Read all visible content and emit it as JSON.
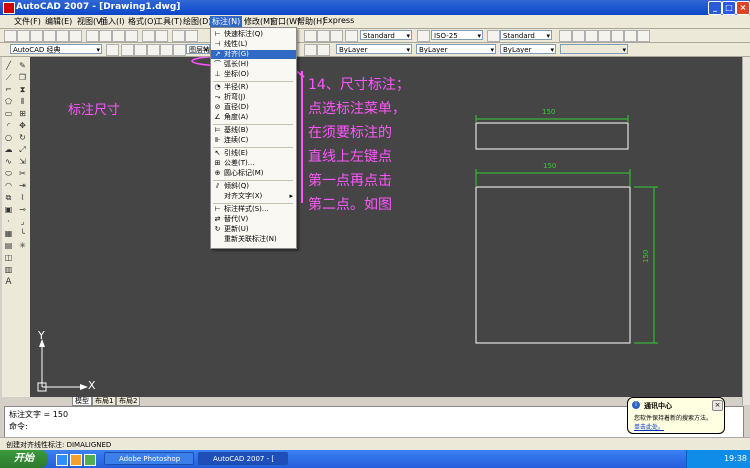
{
  "window": {
    "title": "AutoCAD 2007 - [Drawing1.dwg]",
    "controls": [
      "_",
      "□",
      "×"
    ]
  },
  "menubar": {
    "items": [
      {
        "label": "文件(F)"
      },
      {
        "label": "编辑(E)"
      },
      {
        "label": "视图(V)"
      },
      {
        "label": "插入(I)"
      },
      {
        "label": "格式(O)"
      },
      {
        "label": "工具(T)"
      },
      {
        "label": "绘图(D)"
      },
      {
        "label": "标注(N)",
        "active": true
      },
      {
        "label": "修改(M)"
      },
      {
        "label": "窗口(W)"
      },
      {
        "label": "帮助(H)"
      },
      {
        "label": "Express"
      }
    ]
  },
  "toolbar": {
    "text_style": "Standard",
    "dim_style": "ISO-25",
    "table_style": "Standard",
    "workspace": "AutoCAD 经典",
    "layer_label": "图层特",
    "color": "ByLayer",
    "linetype": "ByLayer",
    "lineweight": "ByLayer"
  },
  "dropdown": {
    "items": [
      {
        "icon": "quick-dim-icon",
        "glyph": "⊢",
        "label": "快速标注(Q)",
        "sep_after": false
      },
      {
        "icon": "linear-dim-icon",
        "glyph": "⊣",
        "label": "线性(L)",
        "sep_after": false
      },
      {
        "icon": "aligned-dim-icon",
        "glyph": "↗",
        "label": "对齐(G)",
        "selected": true,
        "sep_after": false
      },
      {
        "icon": "arc-length-icon",
        "glyph": "⌒",
        "label": "弧长(H)",
        "sep_after": false
      },
      {
        "icon": "ordinate-icon",
        "glyph": "⊥",
        "label": "坐标(O)",
        "sep_after": true
      },
      {
        "icon": "radius-icon",
        "glyph": "◔",
        "label": "半径(R)",
        "sep_after": false
      },
      {
        "icon": "jogged-icon",
        "glyph": "⤳",
        "label": "折弯(J)",
        "sep_after": false
      },
      {
        "icon": "diameter-icon",
        "glyph": "⊘",
        "label": "直径(D)",
        "sep_after": false
      },
      {
        "icon": "angular-icon",
        "glyph": "∠",
        "label": "角度(A)",
        "sep_after": true
      },
      {
        "icon": "baseline-icon",
        "glyph": "⊨",
        "label": "基线(B)",
        "sep_after": false
      },
      {
        "icon": "continue-icon",
        "glyph": "⊪",
        "label": "连续(C)",
        "sep_after": true
      },
      {
        "icon": "leader-icon",
        "glyph": "↖",
        "label": "引线(E)",
        "sep_after": false
      },
      {
        "icon": "tolerance-icon",
        "glyph": "⊞",
        "label": "公差(T)...",
        "sep_after": false
      },
      {
        "icon": "center-mark-icon",
        "glyph": "⊕",
        "label": "圆心标记(M)",
        "sep_after": true
      },
      {
        "icon": "oblique-icon",
        "glyph": "⫽",
        "label": "倾斜(Q)",
        "sep_after": false
      },
      {
        "icon": "",
        "glyph": "",
        "label": "对齐文字(X)",
        "submenu": true,
        "sep_after": true
      },
      {
        "icon": "dim-style-icon",
        "glyph": "⊢",
        "label": "标注样式(S)...",
        "sep_after": false
      },
      {
        "icon": "override-icon",
        "glyph": "⇄",
        "label": "替代(V)",
        "sep_after": false
      },
      {
        "icon": "update-icon",
        "glyph": "↻",
        "label": "更新(U)",
        "sep_after": false
      },
      {
        "icon": "",
        "glyph": "",
        "label": "重新关联标注(N)",
        "sep_after": false
      }
    ]
  },
  "canvas": {
    "label_left": "标注尺寸",
    "instructions": [
      "14、尺寸标注；",
      "点选标注菜单，",
      "在须要标注的",
      "直线上左键点",
      "第一点再点击",
      "第二点。如图"
    ],
    "dim_top": "150",
    "dim_middle": "150",
    "dim_right": "150",
    "ucs_x": "X",
    "ucs_y": "Y",
    "colors": {
      "background": "#454545",
      "annotation": "#ff55ff",
      "dimension": "#33cc33",
      "geometry": "#ffffff"
    }
  },
  "tabs": [
    "模型",
    "布局1",
    "布局2"
  ],
  "command": {
    "line1": "标注文字 = 150",
    "line2": "命令:"
  },
  "status": {
    "text": "创建对齐线性标注: DIMALIGNED"
  },
  "balloon": {
    "title": "通讯中心",
    "body": "您软件保持着新的搜索方法。",
    "link": "单击此处。"
  },
  "taskbar": {
    "start": "开始",
    "tasks": [
      {
        "label": "Adobe Photoshop",
        "active": false
      },
      {
        "label": "AutoCAD 2007 - [",
        "active": true
      }
    ],
    "clock": "19:38"
  }
}
